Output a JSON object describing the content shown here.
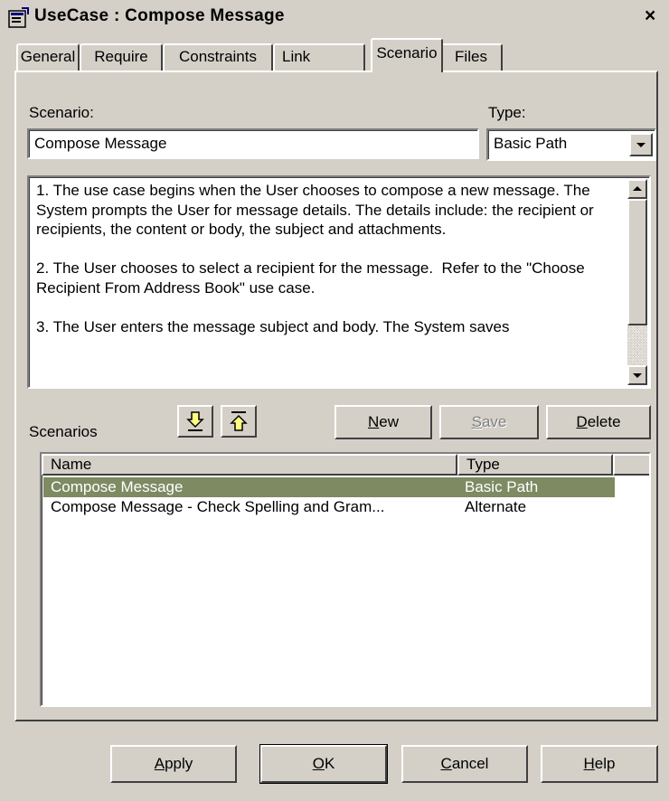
{
  "window": {
    "title": "UseCase : Compose Message",
    "close_glyph": "×",
    "icon": "properties-icon"
  },
  "tabs": [
    {
      "label": "General",
      "active": false
    },
    {
      "label": "Require",
      "active": false
    },
    {
      "label": "Constraints",
      "active": false
    },
    {
      "label": "Link",
      "active": false
    },
    {
      "label": "Scenario",
      "active": true
    },
    {
      "label": "Files",
      "active": false
    }
  ],
  "scenario": {
    "label": "Scenario:",
    "value": "Compose Message",
    "type_label": "Type:",
    "type_value": "Basic Path"
  },
  "description": {
    "text": "1. The use case begins when the User chooses to compose a new message. The System prompts the User for message details. The details include: the recipient or recipients, the content or body, the subject and attachments.\n\n2. The User chooses to select a recipient for the message.  Refer to the \"Choose Recipient From Address Book\" use case.\n\n3. The User enters the message subject and body. The System saves"
  },
  "scenarios_section": {
    "label": "Scenarios",
    "move_up_icon": "move-up-icon",
    "move_down_icon": "move-down-icon",
    "new_button": {
      "pre": "",
      "accel": "N",
      "post": "ew"
    },
    "save_button": {
      "pre": "",
      "accel": "S",
      "post": "ave",
      "disabled": true
    },
    "delete_button": {
      "pre": "",
      "accel": "D",
      "post": "elete"
    }
  },
  "list": {
    "columns": [
      "Name",
      "Type"
    ],
    "rows": [
      {
        "name": "Compose Message",
        "type": "Basic Path",
        "selected": true
      },
      {
        "name": "Compose Message - Check Spelling and Gram...",
        "type": "Alternate",
        "selected": false
      }
    ]
  },
  "footer": {
    "apply": {
      "pre": "",
      "accel": "A",
      "post": "pply"
    },
    "ok": {
      "pre": "",
      "accel": "O",
      "post": "K"
    },
    "cancel": {
      "pre": "",
      "accel": "C",
      "post": "ancel"
    },
    "help": {
      "pre": "",
      "accel": "H",
      "post": "elp"
    }
  },
  "colors": {
    "face": "#d4d0c8",
    "selection": "#7d8a62"
  }
}
